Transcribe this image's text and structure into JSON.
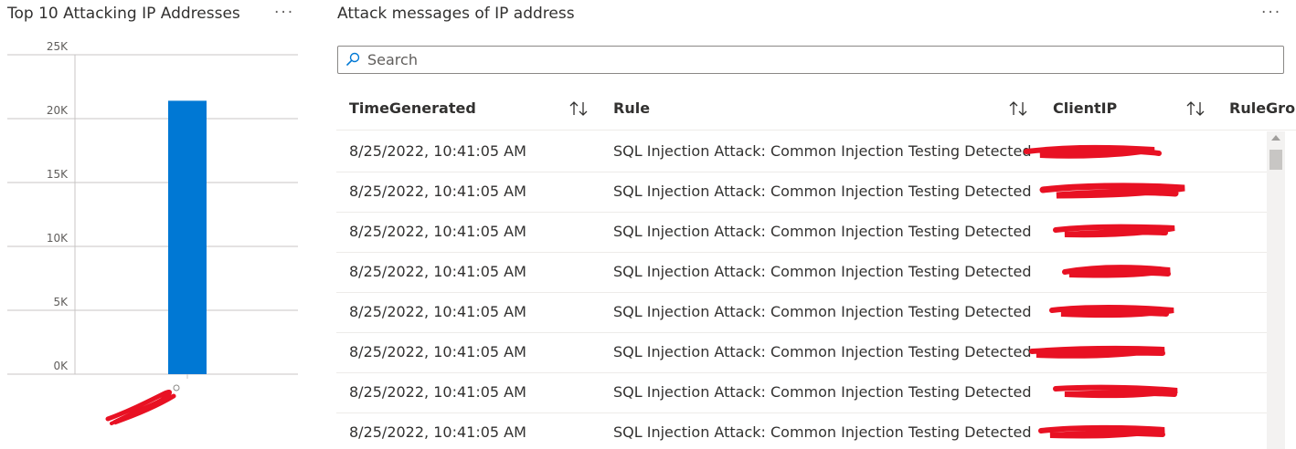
{
  "left_panel": {
    "title": "Top 10 Attacking IP Addresses",
    "more_icon": "more-ellipsis-icon",
    "more_label": "···"
  },
  "chart_data": {
    "type": "bar",
    "categories": [
      ""
    ],
    "values": [
      21400
    ],
    "ylim": [
      0,
      25000
    ],
    "yticks": [
      "0K",
      "5K",
      "10K",
      "15K",
      "20K",
      "25K"
    ],
    "grid": true,
    "bar_color": "#0078d4",
    "redaction_color": "#e81123"
  },
  "right_panel": {
    "title": "Attack messages of IP address",
    "more_label": "···",
    "search": {
      "placeholder": "Search",
      "value": ""
    },
    "columns": [
      {
        "label": "TimeGenerated"
      },
      {
        "label": "Rule"
      },
      {
        "label": "ClientIP"
      },
      {
        "label": "RuleGro"
      }
    ],
    "rows": [
      {
        "time": "8/25/2022, 10:41:05 AM",
        "rule": "SQL Injection Attack: Common Injection Testing Detected"
      },
      {
        "time": "8/25/2022, 10:41:05 AM",
        "rule": "SQL Injection Attack: Common Injection Testing Detected"
      },
      {
        "time": "8/25/2022, 10:41:05 AM",
        "rule": "SQL Injection Attack: Common Injection Testing Detected"
      },
      {
        "time": "8/25/2022, 10:41:05 AM",
        "rule": "SQL Injection Attack: Common Injection Testing Detected"
      },
      {
        "time": "8/25/2022, 10:41:05 AM",
        "rule": "SQL Injection Attack: Common Injection Testing Detected"
      },
      {
        "time": "8/25/2022, 10:41:05 AM",
        "rule": "SQL Injection Attack: Common Injection Testing Detected"
      },
      {
        "time": "8/25/2022, 10:41:05 AM",
        "rule": "SQL Injection Attack: Common Injection Testing Detected"
      },
      {
        "time": "8/25/2022, 10:41:05 AM",
        "rule": "SQL Injection Attack: Common Injection Testing Detected"
      }
    ]
  }
}
